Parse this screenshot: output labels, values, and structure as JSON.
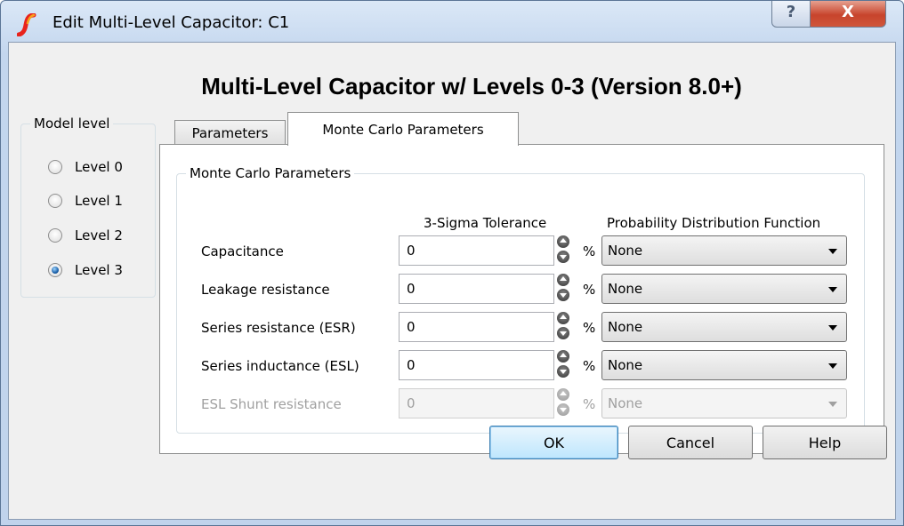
{
  "window": {
    "title": "Edit Multi-Level Capacitor: C1",
    "help_glyph": "?",
    "close_glyph": "X"
  },
  "heading": "Multi-Level Capacitor w/ Levels 0-3 (Version 8.0+)",
  "model_level": {
    "legend": "Model level",
    "options": [
      {
        "label": "Level 0",
        "selected": false
      },
      {
        "label": "Level 1",
        "selected": false
      },
      {
        "label": "Level 2",
        "selected": false
      },
      {
        "label": "Level 3",
        "selected": true
      }
    ]
  },
  "tabs": [
    {
      "label": "Parameters",
      "active": false
    },
    {
      "label": "Monte Carlo Parameters",
      "active": true
    }
  ],
  "monte_carlo": {
    "legend": "Monte Carlo Parameters",
    "col_tolerance": "3-Sigma Tolerance",
    "col_pdf": "Probability Distribution Function",
    "unit": "%",
    "rows": [
      {
        "label": "Capacitance",
        "value": "0",
        "pdf": "None",
        "enabled": true
      },
      {
        "label": "Leakage resistance",
        "value": "0",
        "pdf": "None",
        "enabled": true
      },
      {
        "label": "Series resistance (ESR)",
        "value": "0",
        "pdf": "None",
        "enabled": true
      },
      {
        "label": "Series inductance (ESL)",
        "value": "0",
        "pdf": "None",
        "enabled": true
      },
      {
        "label": "ESL Shunt resistance",
        "value": "0",
        "pdf": "None",
        "enabled": false
      }
    ]
  },
  "buttons": {
    "ok": "OK",
    "cancel": "Cancel",
    "help": "Help"
  },
  "colors": {
    "title_bar": "#c3d6ee",
    "close_button": "#c7442c",
    "default_button": "#bee6fd",
    "disabled_text": "#a0a0a0"
  }
}
